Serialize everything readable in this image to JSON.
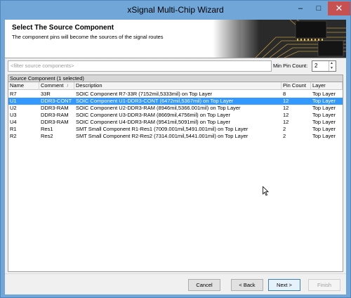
{
  "window": {
    "title": "xSignal Multi-Chip Wizard",
    "minimize": "–",
    "maximize": "□",
    "close": "✕"
  },
  "header": {
    "title": "Select The Source Component",
    "subtitle": "The component pins will become the sources of the signal routes",
    "art_icon": "chip-board-image"
  },
  "filter": {
    "placeholder": "<filter source components>",
    "value": ""
  },
  "min_pin": {
    "label": "Min Pin Count:",
    "value": "2"
  },
  "group": {
    "label": "Source Component (1 selected)"
  },
  "table": {
    "columns": [
      "Name",
      "Comment",
      "Description",
      "Pin Count",
      "Layer"
    ],
    "sort_column": "Comment",
    "rows": [
      {
        "name": "R7",
        "comment": "33R",
        "description": "SOIC Component R7-33R (7152mil,5333mil) on Top Layer",
        "pins": "8",
        "layer": "Top Layer",
        "selected": false
      },
      {
        "name": "U1",
        "comment": "DDR3-CONT",
        "description": "SOIC Component U1-DDR3-CONT (6472mil,5367mil) on Top Layer",
        "pins": "12",
        "layer": "Top Layer",
        "selected": true
      },
      {
        "name": "U2",
        "comment": "DDR3-RAM",
        "description": "SOIC Component U2-DDR3-RAM (8946mil,5366.001mil) on Top Layer",
        "pins": "12",
        "layer": "Top Layer",
        "selected": false
      },
      {
        "name": "U3",
        "comment": "DDR3-RAM",
        "description": "SOIC Component U3-DDR3-RAM (8669mil,4756mil) on Top Layer",
        "pins": "12",
        "layer": "Top Layer",
        "selected": false
      },
      {
        "name": "U4",
        "comment": "DDR3-RAM",
        "description": "SOIC Component U4-DDR3-RAM (9541mil,5091mil) on Top Layer",
        "pins": "12",
        "layer": "Top Layer",
        "selected": false
      },
      {
        "name": "R1",
        "comment": "Res1",
        "description": "SMT Small Component R1-Res1 (7009.001mil,5491.001mil) on Top Layer",
        "pins": "2",
        "layer": "Top Layer",
        "selected": false
      },
      {
        "name": "R2",
        "comment": "Res2",
        "description": "SMT Small Component R2-Res2 (7314.001mil,5441.001mil) on Top Layer",
        "pins": "2",
        "layer": "Top Layer",
        "selected": false
      }
    ]
  },
  "buttons": {
    "cancel": "Cancel",
    "back": "< Back",
    "next": "Next >",
    "finish": "Finish"
  },
  "colors": {
    "titlebar": "#70a7d8",
    "selection": "#3399ff",
    "close": "#c75050"
  }
}
